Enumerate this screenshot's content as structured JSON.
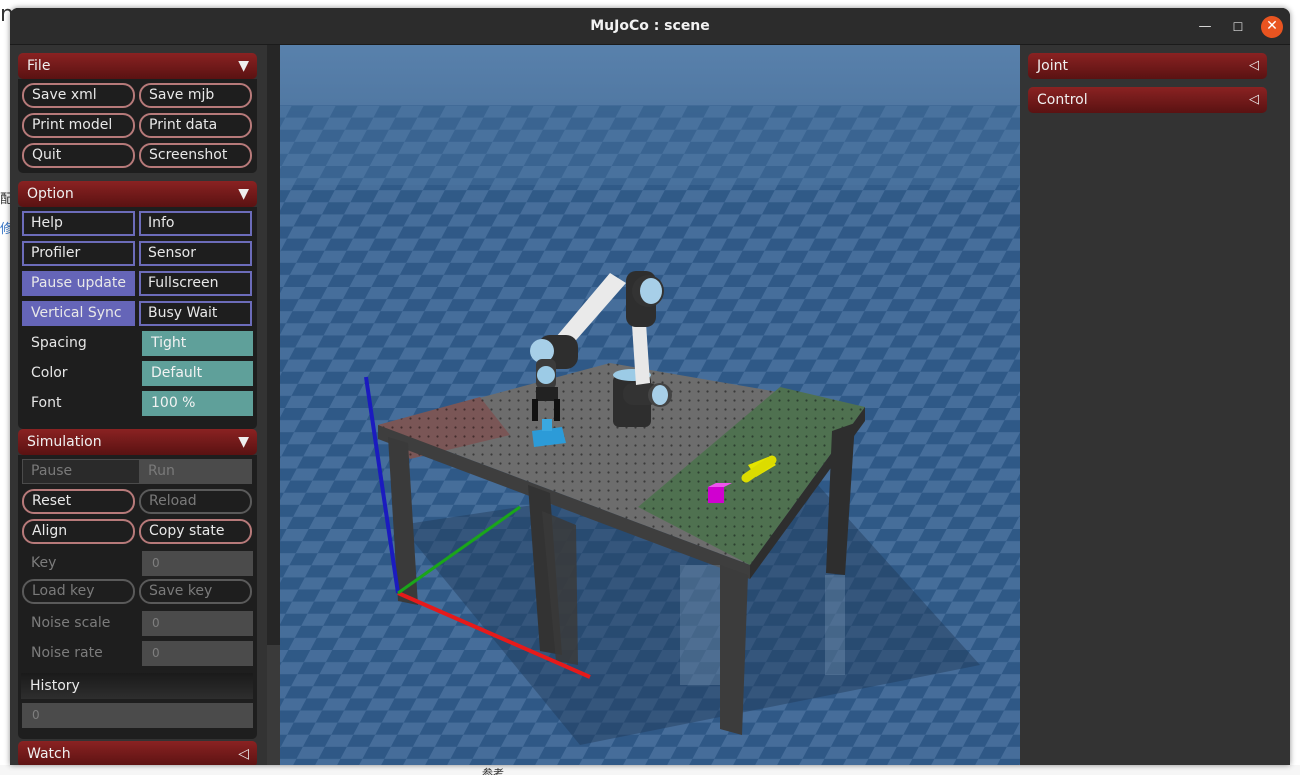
{
  "window": {
    "title": "MuJoCo : scene",
    "minimize_glyph": "—",
    "maximize_glyph": "☐",
    "close_glyph": "✕"
  },
  "background_app": {
    "glyph_1": "n",
    "glyph_2": "配",
    "glyph_3": "修",
    "bottom_text": "参考"
  },
  "panels": {
    "file": {
      "title": "File",
      "arrow": "▼",
      "buttons": {
        "save_xml": "Save xml",
        "save_mjb": "Save mjb",
        "print_model": "Print model",
        "print_data": "Print data",
        "quit": "Quit",
        "screenshot": "Screenshot"
      }
    },
    "option": {
      "title": "Option",
      "arrow": "▼",
      "checks": {
        "help": "Help",
        "info": "Info",
        "profiler": "Profiler",
        "sensor": "Sensor",
        "pause_update": "Pause update",
        "fullscreen": "Fullscreen",
        "vertical_sync": "Vertical Sync",
        "busy_wait": "Busy Wait"
      },
      "spacing_label": "Spacing",
      "spacing_value": "Tight",
      "color_label": "Color",
      "color_value": "Default",
      "font_label": "Font",
      "font_value": "100 %"
    },
    "simulation": {
      "title": "Simulation",
      "arrow": "▼",
      "pause": "Pause",
      "run": "Run",
      "reset": "Reset",
      "reload": "Reload",
      "align": "Align",
      "copy_state": "Copy state",
      "key_label": "Key",
      "key_value": "0",
      "load_key": "Load key",
      "save_key": "Save key",
      "noise_scale_label": "Noise scale",
      "noise_scale_value": "0",
      "noise_rate_label": "Noise rate",
      "noise_rate_value": "0",
      "history_label": "History",
      "history_value": "0"
    },
    "watch": {
      "title": "Watch",
      "arrow": "◁"
    },
    "joint": {
      "title": "Joint",
      "arrow": "◁"
    },
    "control": {
      "title": "Control",
      "arrow": "◁"
    }
  },
  "colors": {
    "section_red": "#8a2222",
    "check_on": "#6565b8",
    "select_teal": "#5fa09a",
    "close_orange": "#e95420"
  },
  "icons": {
    "collapse": "triangle-down-icon",
    "expand": "triangle-left-icon"
  }
}
